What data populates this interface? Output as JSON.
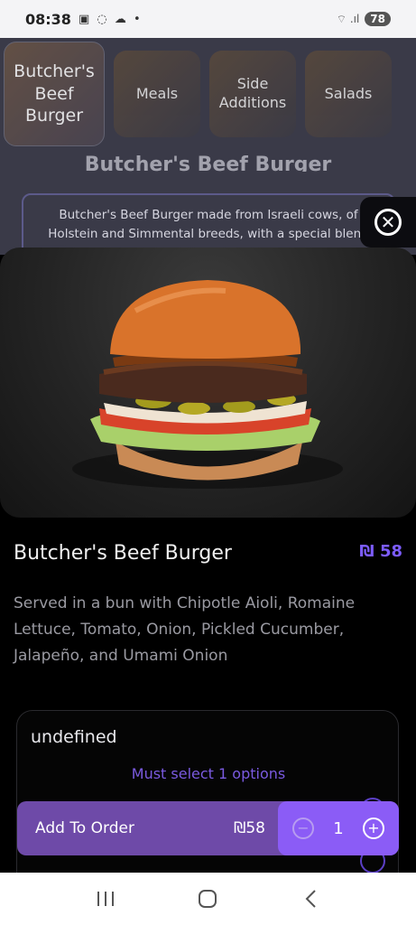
{
  "status_bar": {
    "time": "08:38",
    "left_icons": "▣ ◌ ☁ •",
    "right_icons": "⌔ .ıl",
    "battery": "78"
  },
  "background_menu": {
    "categories": [
      {
        "label": "Butcher's Beef Burger"
      },
      {
        "label": "Meals"
      },
      {
        "label": "Side Additions"
      },
      {
        "label": "Salads"
      }
    ],
    "section_title": "Butcher's Beef Burger",
    "description": "Butcher's Beef Burger made from Israeli cows, of Holstein and Simmental breeds, with a special blend"
  },
  "product": {
    "name": "Butcher's Beef Burger",
    "price": "₪ 58",
    "description": "Served in a bun with Chipotle Aioli, Romaine Lettuce, Tomato, Onion, Pickled Cucumber, Jalapeño, and Umami Onion"
  },
  "options": {
    "title": "undefined",
    "hint": "Must select 1 options"
  },
  "order_bar": {
    "label": "Add To Order",
    "price": "₪58",
    "quantity": "1",
    "minus_symbol": "−",
    "plus_symbol": "+"
  },
  "icons": {
    "close": "close-icon",
    "minus": "minus-icon",
    "plus": "plus-icon",
    "recents": "recents-icon",
    "home": "home-icon",
    "back": "back-icon"
  },
  "colors": {
    "accent": "#8b5cf6",
    "add_bar": "#6e4aa8",
    "price": "#7c5cff"
  }
}
